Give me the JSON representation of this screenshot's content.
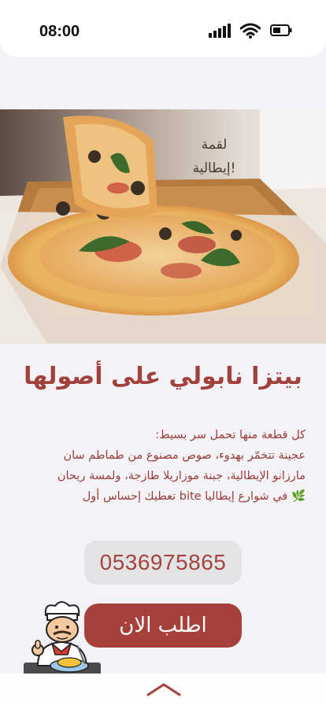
{
  "status": {
    "time": "08:00"
  },
  "hero": {
    "overlay_line1": "لقمة",
    "overlay_line2": "إيطالية!"
  },
  "title": "بيتزا نابولي على أصولها",
  "description": {
    "lines": [
      "كل قطعة منها تحمل سر بسيط:",
      "عجينة تتخمّر بهدوء، صوص مصنوع من طماطم سان",
      "مارزانو الإيطالية، جبنة موزاريلا طازجة، ولمسة ريحان",
      "🌿 في شوارع إيطاليا bite تعطيك إحساس أول"
    ]
  },
  "phone_number": "0536975865",
  "order_button": "اطلب الان",
  "icons": {
    "signal": "signal-bars-icon",
    "wifi": "wifi-icon",
    "battery": "battery-icon",
    "chef": "chef-mascot-icon",
    "chevron": "chevron-up-icon"
  },
  "colors": {
    "accent": "#a6403b",
    "background": "#f3f2f6"
  }
}
